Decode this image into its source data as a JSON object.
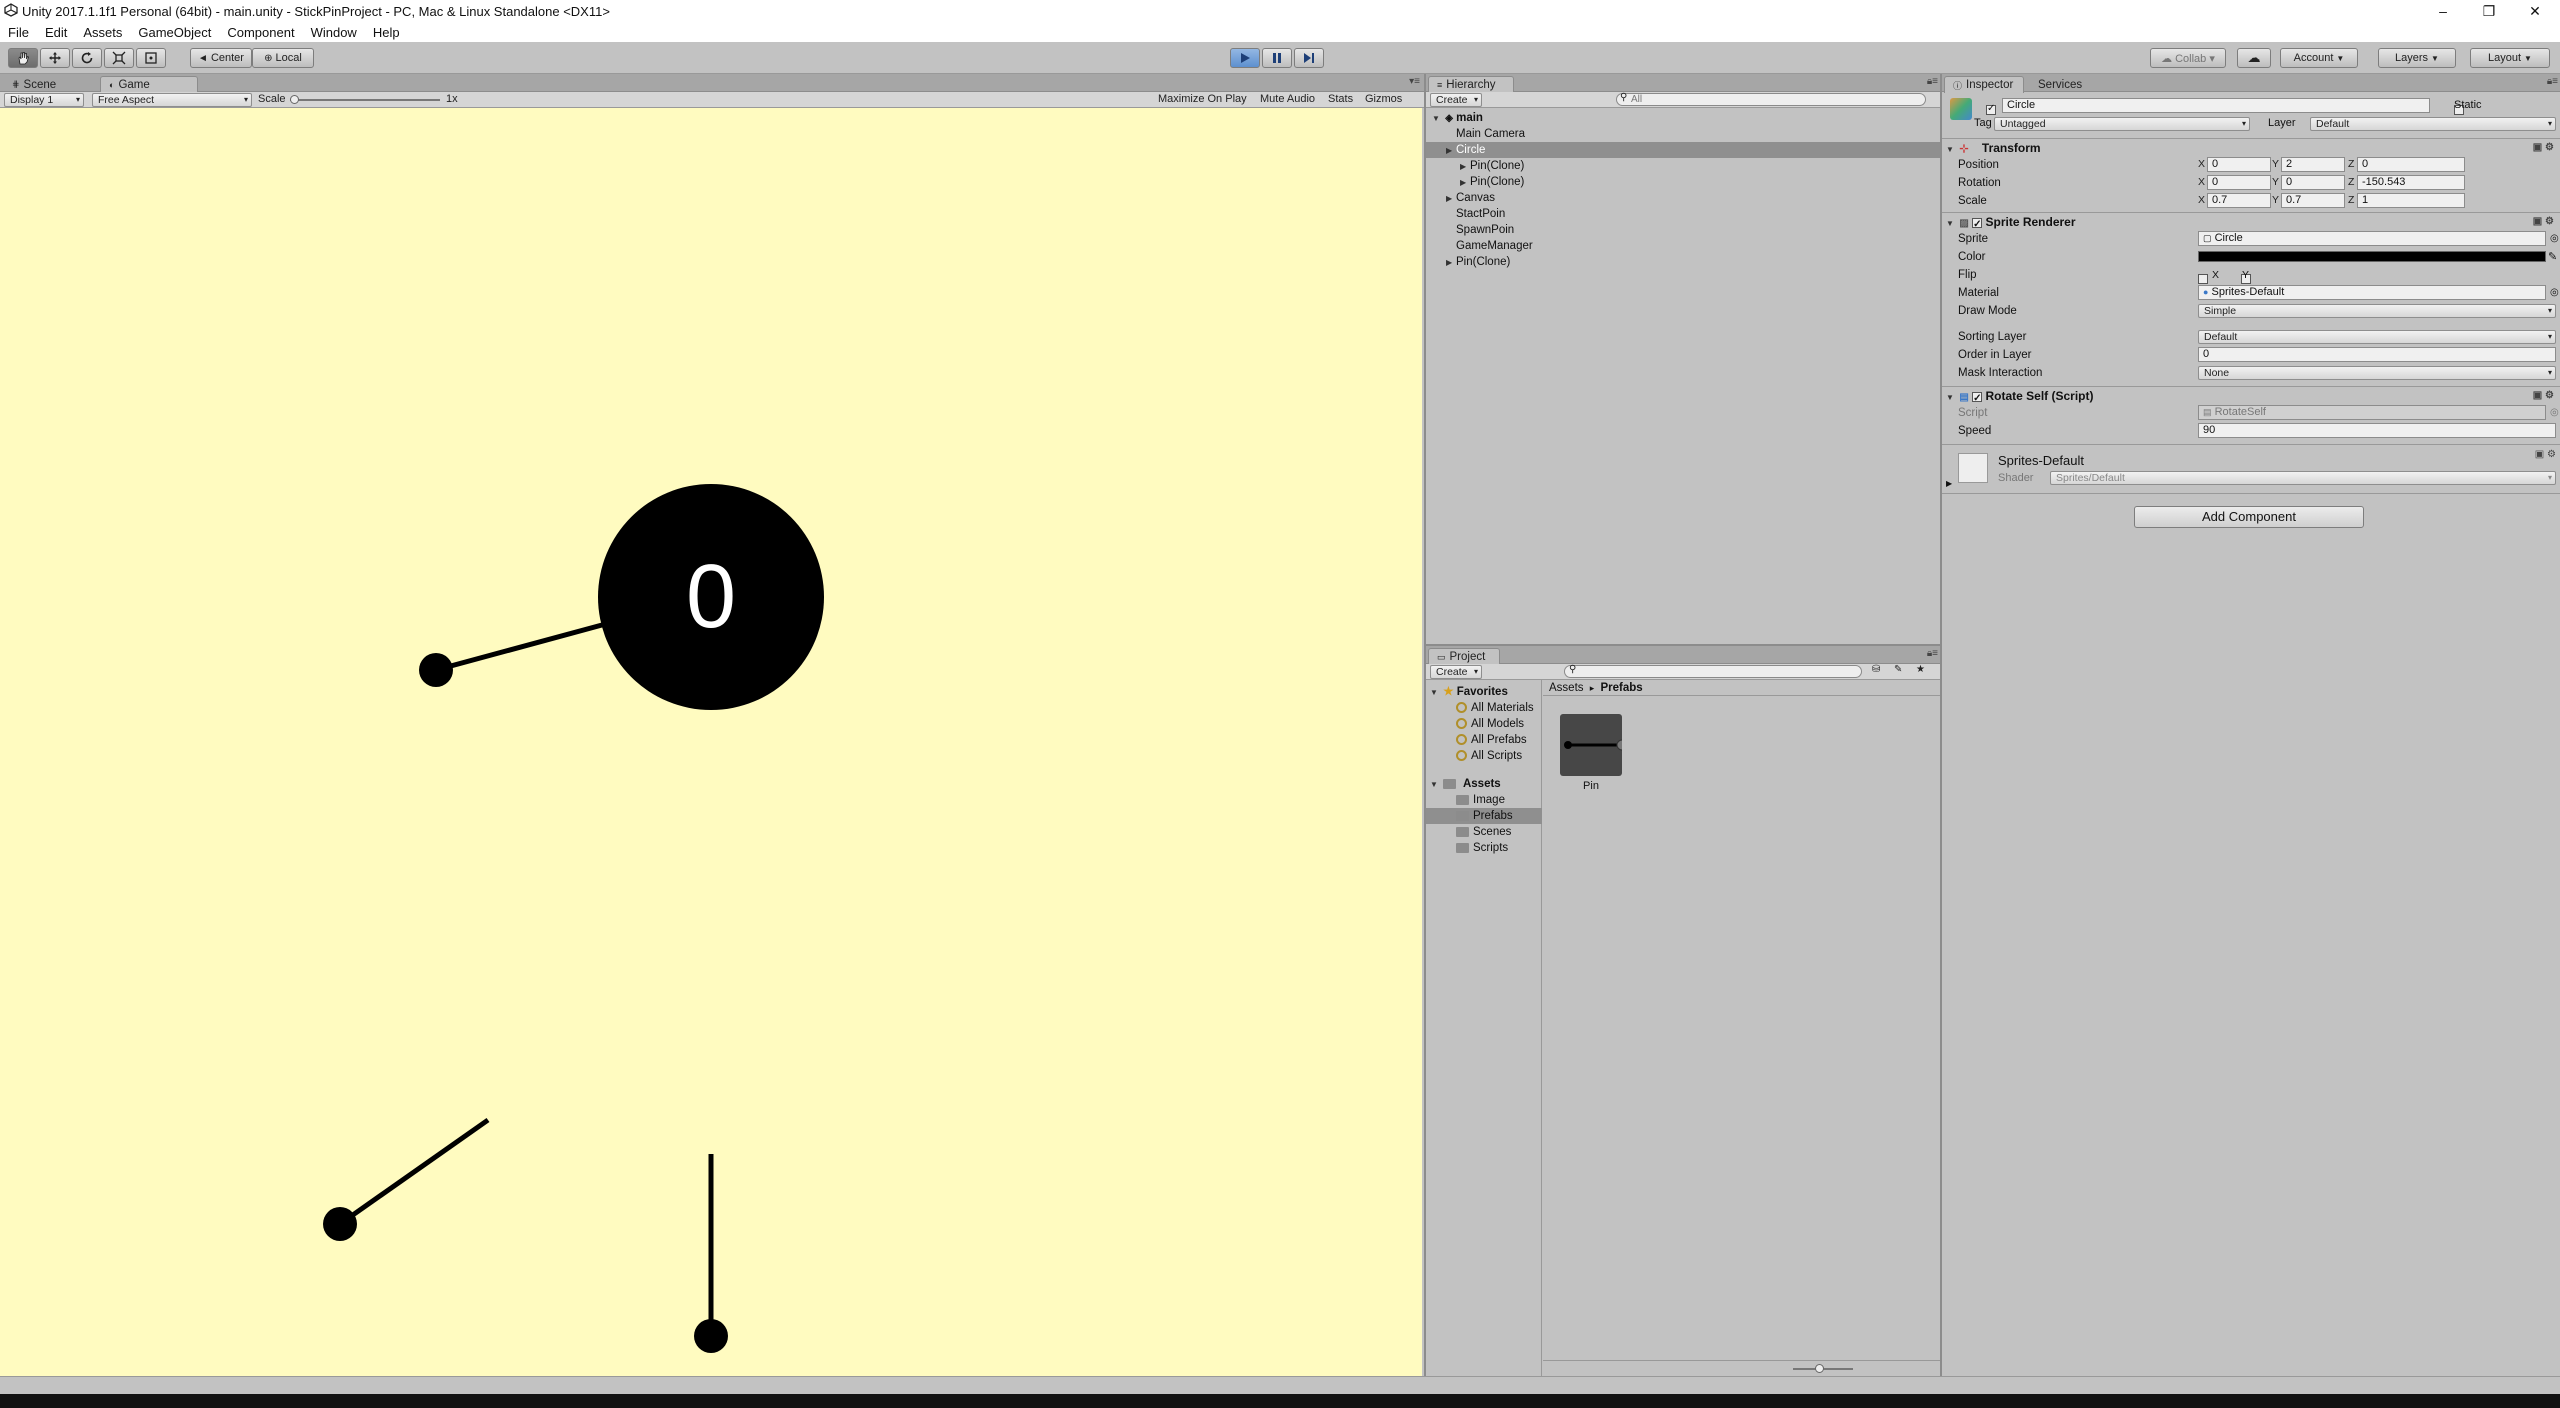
{
  "window": {
    "title": "Unity 2017.1.1f1 Personal (64bit) - main.unity - StickPinProject - PC, Mac & Linux Standalone <DX11>",
    "minimize": "–",
    "maximize": "❐",
    "close": "✕"
  },
  "menu": [
    "File",
    "Edit",
    "Assets",
    "GameObject",
    "Component",
    "Window",
    "Help"
  ],
  "toolbar": {
    "pivot": "Center",
    "space": "Local",
    "collab": "Collab ▾",
    "account": "Account",
    "layers": "Layers",
    "layout": "Layout"
  },
  "scene_tabs": {
    "scene": "Scene",
    "game": "Game"
  },
  "game_bar": {
    "display": "Display 1",
    "aspect": "Free Aspect",
    "scale_label": "Scale",
    "scale_value": "1x",
    "maximize": "Maximize On Play",
    "mute": "Mute Audio",
    "stats": "Stats",
    "gizmos": "Gizmos"
  },
  "game_view": {
    "background": "#fffbc0",
    "score": "0"
  },
  "hierarchy": {
    "tab": "Hierarchy",
    "create": "Create",
    "search_placeholder": "All",
    "scene": "main",
    "items": [
      {
        "label": "Main Camera",
        "indent": 1,
        "arrow": false,
        "selected": false
      },
      {
        "label": "Circle",
        "indent": 1,
        "arrow": true,
        "selected": true
      },
      {
        "label": "Pin(Clone)",
        "indent": 2,
        "arrow": true,
        "selected": false
      },
      {
        "label": "Pin(Clone)",
        "indent": 2,
        "arrow": true,
        "selected": false
      },
      {
        "label": "Canvas",
        "indent": 1,
        "arrow": true,
        "selected": false
      },
      {
        "label": "StactPoin",
        "indent": 1,
        "arrow": false,
        "selected": false
      },
      {
        "label": "SpawnPoin",
        "indent": 1,
        "arrow": false,
        "selected": false
      },
      {
        "label": "GameManager",
        "indent": 1,
        "arrow": false,
        "selected": false
      },
      {
        "label": "Pin(Clone)",
        "indent": 1,
        "arrow": true,
        "selected": false
      }
    ]
  },
  "project": {
    "tab": "Project",
    "create": "Create",
    "favorites": "Favorites",
    "fav_items": [
      "All Materials",
      "All Models",
      "All Prefabs",
      "All Scripts"
    ],
    "assets": "Assets",
    "asset_folders": [
      "Image",
      "Prefabs",
      "Scenes",
      "Scripts"
    ],
    "breadcrumb_root": "Assets",
    "breadcrumb_sep": "▸",
    "breadcrumb_current": "Prefabs",
    "prefab_name": "Pin"
  },
  "inspector": {
    "tab": "Inspector",
    "services_tab": "Services",
    "object_name": "Circle",
    "static_label": "Static",
    "tag_label": "Tag",
    "tag_value": "Untagged",
    "layer_label": "Layer",
    "layer_value": "Default",
    "transform": {
      "title": "Transform",
      "position_label": "Position",
      "rotation_label": "Rotation",
      "scale_label": "Scale",
      "position": {
        "x": "0",
        "y": "2",
        "z": "0"
      },
      "rotation": {
        "x": "0",
        "y": "0",
        "z": "-150.543"
      },
      "scale": {
        "x": "0.7",
        "y": "0.7",
        "z": "1"
      }
    },
    "sprite_renderer": {
      "title": "Sprite Renderer",
      "sprite_label": "Sprite",
      "sprite_value": "Circle",
      "color_label": "Color",
      "color_value": "#000000",
      "flip_label": "Flip",
      "flip_x": "X",
      "flip_y": "Y",
      "material_label": "Material",
      "material_value": "Sprites-Default",
      "draw_mode_label": "Draw Mode",
      "draw_mode_value": "Simple",
      "sorting_layer_label": "Sorting Layer",
      "sorting_layer_value": "Default",
      "order_label": "Order in Layer",
      "order_value": "0",
      "mask_label": "Mask Interaction",
      "mask_value": "None"
    },
    "rotate_self": {
      "title": "Rotate Self (Script)",
      "script_label": "Script",
      "script_value": "RotateSelf",
      "speed_label": "Speed",
      "speed_value": "90"
    },
    "material": {
      "name": "Sprites-Default",
      "shader_label": "Shader",
      "shader_value": "Sprites/Default"
    },
    "add_component": "Add Component"
  }
}
